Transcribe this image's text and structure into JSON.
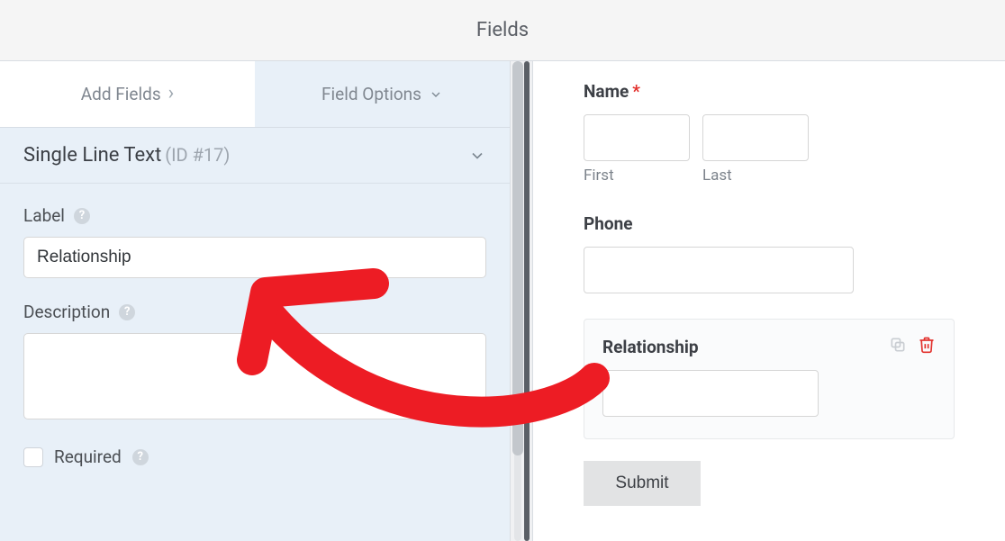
{
  "header": {
    "title": "Fields"
  },
  "tabs": {
    "add_fields": "Add Fields",
    "field_options": "Field Options"
  },
  "field": {
    "type_label": "Single Line Text",
    "id_label": "(ID #17)",
    "label_heading": "Label",
    "label_value": "Relationship",
    "description_heading": "Description",
    "description_value": "",
    "required_label": "Required"
  },
  "preview": {
    "name_label": "Name",
    "first_label": "First",
    "last_label": "Last",
    "phone_label": "Phone",
    "relationship_label": "Relationship",
    "submit_label": "Submit"
  }
}
